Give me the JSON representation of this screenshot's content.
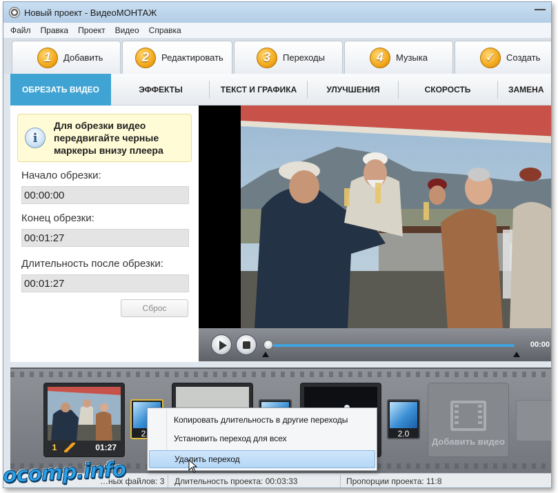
{
  "window": {
    "title": "Новый проект - ВидеоМОНТАЖ"
  },
  "menu": [
    "Файл",
    "Правка",
    "Проект",
    "Видео",
    "Справка"
  ],
  "tabs": [
    {
      "num": "1",
      "label": "Добавить"
    },
    {
      "num": "2",
      "label": "Редактировать"
    },
    {
      "num": "3",
      "label": "Переходы"
    },
    {
      "num": "4",
      "label": "Музыка"
    },
    {
      "num": "✓",
      "label": "Создать"
    }
  ],
  "subtabs": [
    "ОБРЕЗАТЬ ВИДЕО",
    "ЭФФЕКТЫ",
    "ТЕКСТ И ГРАФИКА",
    "УЛУЧШЕНИЯ",
    "СКОРОСТЬ",
    "ЗАМЕНА"
  ],
  "trim": {
    "tip": "Для обрезки видео передвигайте черные маркеры внизу плеера",
    "start_label": "Начало обрезки:",
    "start_value": "00:00:00",
    "end_label": "Конец обрезки:",
    "end_value": "00:01:27",
    "duration_label": "Длительность после обрезки:",
    "duration_value": "00:01:27",
    "reset_label": "Сброс"
  },
  "player": {
    "time": "00:00",
    "progress": 0.0
  },
  "timeline": {
    "clip1": {
      "num": "1",
      "duration": "01:27"
    },
    "transition1": {
      "value": "2.0"
    },
    "transition3": {
      "value": "2.0"
    },
    "add_video_label": "Добавить видео"
  },
  "context_menu": [
    "Копировать длительность  в другие переходы",
    "Установить переход для всех",
    "Удалить переход"
  ],
  "status": {
    "files": "…ных файлов: 3",
    "duration": "Длительность проекта: 00:03:33",
    "aspect": "Пропорции проекта: 11:8"
  },
  "watermark": "ocomp.info"
}
